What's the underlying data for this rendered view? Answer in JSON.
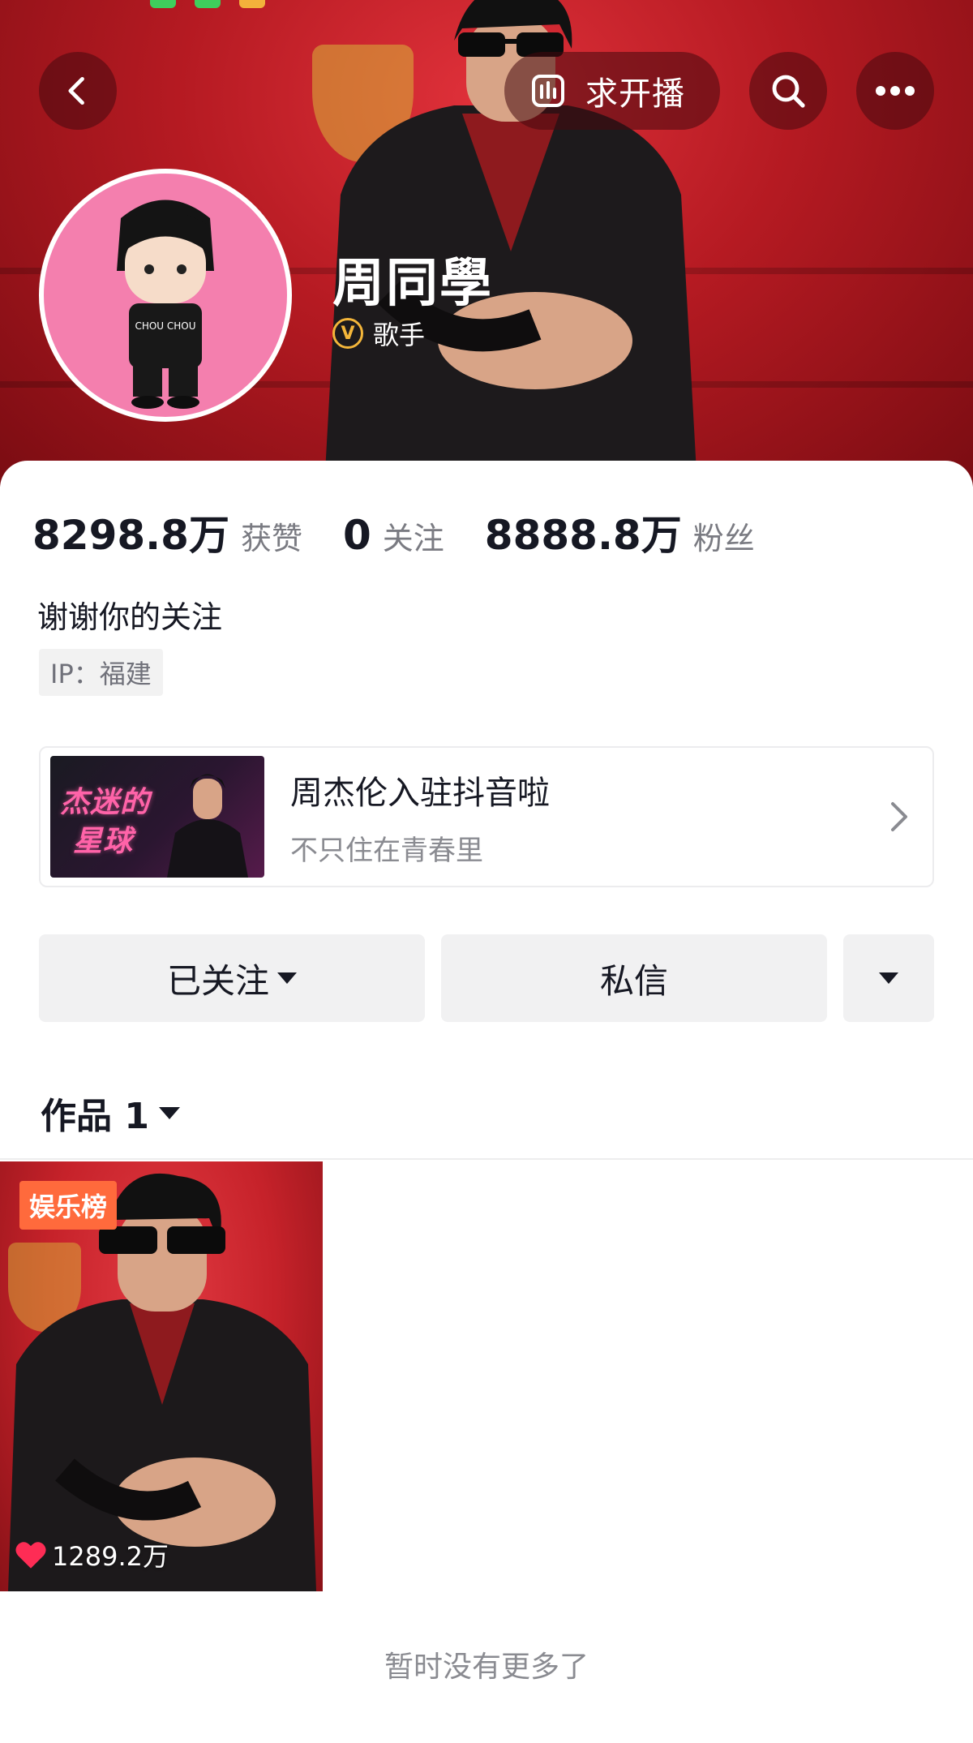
{
  "header": {
    "request_live_label": "求开播",
    "icons": {
      "back": "chevron-left-icon",
      "live": "bar-chart-icon",
      "search": "search-icon",
      "more": "more-horizontal-icon"
    }
  },
  "profile": {
    "name": "周同學",
    "verified_badge": "V",
    "verified_label": "歌手",
    "avatar_shirt_text": "CHOU CHOU"
  },
  "stats": [
    {
      "value": "8298.8万",
      "label": "获赞"
    },
    {
      "value": "0",
      "label": "关注"
    },
    {
      "value": "8888.8万",
      "label": "粉丝"
    }
  ],
  "bio": "谢谢你的关注",
  "ip_location": "IP：福建",
  "promo": {
    "thumb_line1": "杰迷的",
    "thumb_line2": "星球",
    "title": "周杰伦入驻抖音啦",
    "subtitle": "不只住在青春里"
  },
  "actions": {
    "follow_label": "已关注",
    "message_label": "私信"
  },
  "works": {
    "tab_label": "作品 1",
    "items": [
      {
        "badge": "娱乐榜",
        "likes": "1289.2万"
      }
    ]
  },
  "footer_note": "暂时没有更多了",
  "colors": {
    "header_red": "#b51a22",
    "badge_orange": "#ff6a3c",
    "verified_gold": "#f4b63a",
    "like_red": "#fe2c55"
  }
}
